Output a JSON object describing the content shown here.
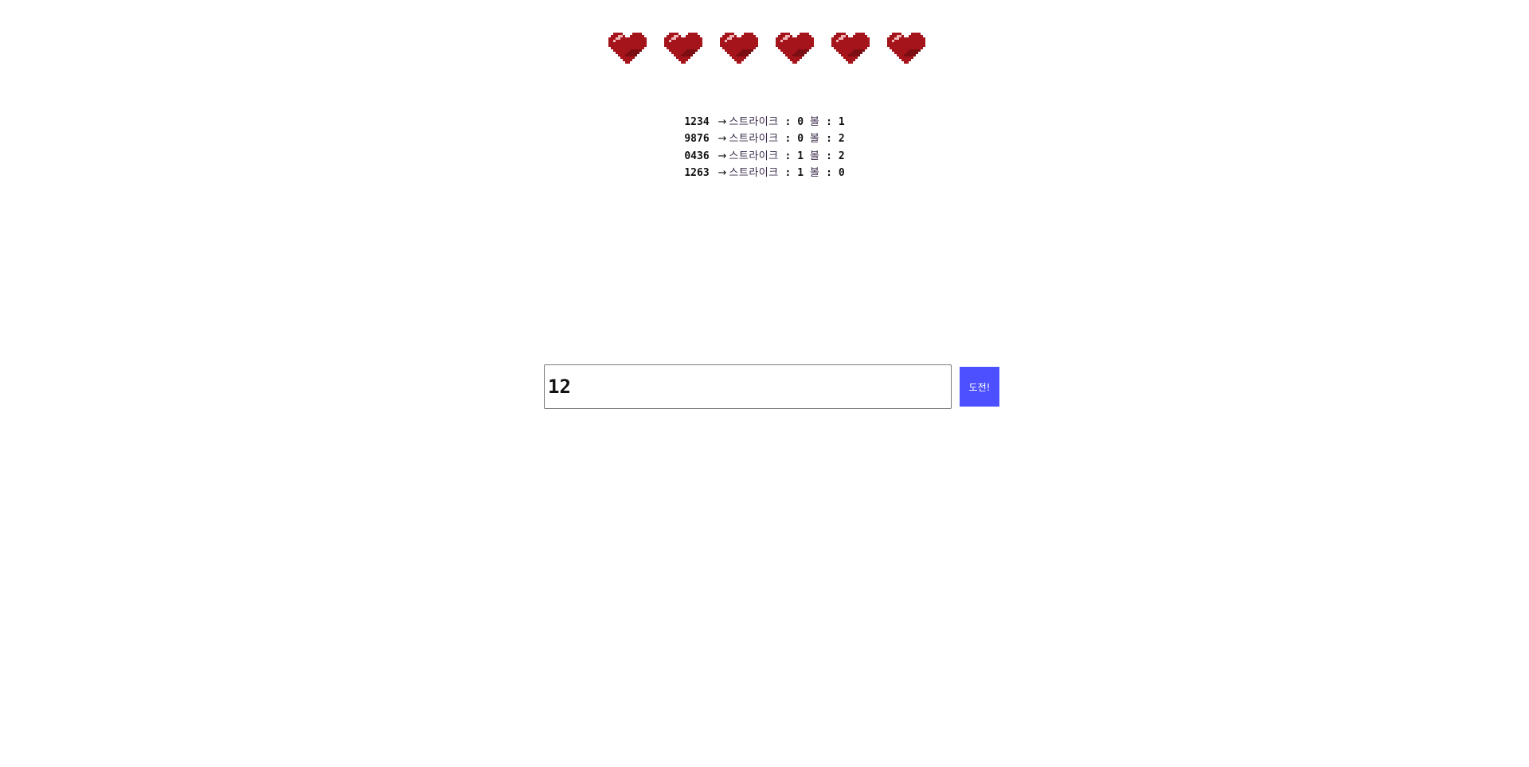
{
  "lives": {
    "count": 6,
    "icon": "pixel-heart-icon",
    "color": "#a5141b",
    "shadow_color": "#7c0e13",
    "highlight_color": "#f2b8b8"
  },
  "history": [
    {
      "guess": "1234",
      "arrow": "→",
      "strike_label": "스트라이크",
      "strike_sep": ":",
      "strike": "0",
      "ball_label": "볼",
      "ball_sep": ":",
      "ball": "1"
    },
    {
      "guess": "9876",
      "arrow": "→",
      "strike_label": "스트라이크",
      "strike_sep": ":",
      "strike": "0",
      "ball_label": "볼",
      "ball_sep": ":",
      "ball": "2"
    },
    {
      "guess": "0436",
      "arrow": "→",
      "strike_label": "스트라이크",
      "strike_sep": ":",
      "strike": "1",
      "ball_label": "볼",
      "ball_sep": ":",
      "ball": "2"
    },
    {
      "guess": "1263",
      "arrow": "→",
      "strike_label": "스트라이크",
      "strike_sep": ":",
      "strike": "1",
      "ball_label": "볼",
      "ball_sep": ":",
      "ball": "0"
    }
  ],
  "input": {
    "value": "12",
    "placeholder": ""
  },
  "submit": {
    "label": "도전!",
    "color": "#4c50ff"
  }
}
